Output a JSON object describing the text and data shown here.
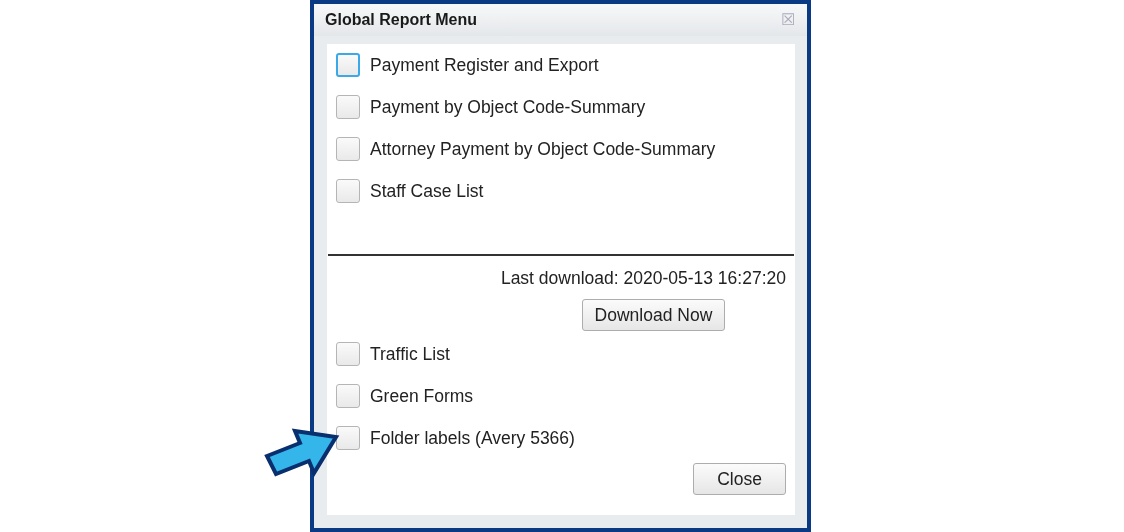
{
  "window": {
    "title": "Global Report Menu",
    "close_symbol": "☒"
  },
  "reports": [
    {
      "label": "Payment Register and Export",
      "checked": false,
      "focused": true
    },
    {
      "label": "Payment by Object Code-Summary",
      "checked": false,
      "focused": false
    },
    {
      "label": "Attorney Payment by Object Code-Summary",
      "checked": false,
      "focused": false
    },
    {
      "label": "Staff Case List",
      "checked": false,
      "focused": false
    }
  ],
  "download": {
    "last_download": "Last download: 2020-05-13 16:27:20",
    "button": "Download Now"
  },
  "lists": [
    {
      "label": "Traffic List",
      "checked": false,
      "focused": false
    },
    {
      "label": "Green Forms",
      "checked": false,
      "focused": false
    },
    {
      "label": "Folder labels (Avery 5366)",
      "checked": false,
      "focused": false
    }
  ],
  "close_button": "Close"
}
